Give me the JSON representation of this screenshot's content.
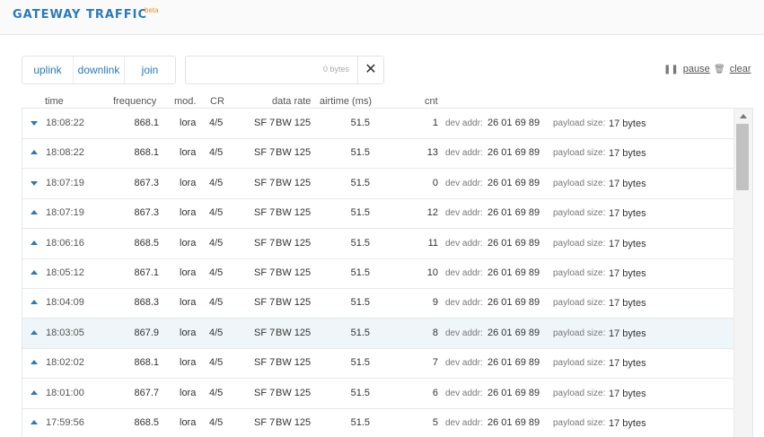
{
  "header": {
    "title": "GATEWAY TRAFFIC",
    "badge": "beta"
  },
  "filters": [
    "uplink",
    "downlink",
    "join"
  ],
  "search": {
    "value": "",
    "bytes_label": "0 bytes",
    "clear_glyph": "✕"
  },
  "controls": {
    "pause_label": "pause",
    "clear_label": "clear",
    "pause_icon": "pause-icon",
    "clear_icon": "trash-icon"
  },
  "columns": {
    "time": "time",
    "frequency": "frequency",
    "mod": "mod.",
    "cr": "CR",
    "data_rate": "data rate",
    "airtime": "airtime (ms)",
    "cnt": "cnt"
  },
  "field_labels": {
    "dev_addr": "dev addr:",
    "payload_size": "payload size:"
  },
  "rows": [
    {
      "direction": "down",
      "time": "18:08:22",
      "frequency": "868.1",
      "mod": "lora",
      "cr": "4/5",
      "sf": "SF 7",
      "bw": "BW 125",
      "airtime": "51.5",
      "cnt": "1",
      "dev_addr": "26 01 69 89",
      "payload": "17 bytes"
    },
    {
      "direction": "up",
      "time": "18:08:22",
      "frequency": "868.1",
      "mod": "lora",
      "cr": "4/5",
      "sf": "SF 7",
      "bw": "BW 125",
      "airtime": "51.5",
      "cnt": "13",
      "dev_addr": "26 01 69 89",
      "payload": "17 bytes"
    },
    {
      "direction": "down",
      "time": "18:07:19",
      "frequency": "867.3",
      "mod": "lora",
      "cr": "4/5",
      "sf": "SF 7",
      "bw": "BW 125",
      "airtime": "51.5",
      "cnt": "0",
      "dev_addr": "26 01 69 89",
      "payload": "17 bytes"
    },
    {
      "direction": "up",
      "time": "18:07:19",
      "frequency": "867.3",
      "mod": "lora",
      "cr": "4/5",
      "sf": "SF 7",
      "bw": "BW 125",
      "airtime": "51.5",
      "cnt": "12",
      "dev_addr": "26 01 69 89",
      "payload": "17 bytes"
    },
    {
      "direction": "up",
      "time": "18:06:16",
      "frequency": "868.5",
      "mod": "lora",
      "cr": "4/5",
      "sf": "SF 7",
      "bw": "BW 125",
      "airtime": "51.5",
      "cnt": "11",
      "dev_addr": "26 01 69 89",
      "payload": "17 bytes"
    },
    {
      "direction": "up",
      "time": "18:05:12",
      "frequency": "867.1",
      "mod": "lora",
      "cr": "4/5",
      "sf": "SF 7",
      "bw": "BW 125",
      "airtime": "51.5",
      "cnt": "10",
      "dev_addr": "26 01 69 89",
      "payload": "17 bytes"
    },
    {
      "direction": "up",
      "time": "18:04:09",
      "frequency": "868.3",
      "mod": "lora",
      "cr": "4/5",
      "sf": "SF 7",
      "bw": "BW 125",
      "airtime": "51.5",
      "cnt": "9",
      "dev_addr": "26 01 69 89",
      "payload": "17 bytes"
    },
    {
      "direction": "up",
      "time": "18:03:05",
      "frequency": "867.9",
      "mod": "lora",
      "cr": "4/5",
      "sf": "SF 7",
      "bw": "BW 125",
      "airtime": "51.5",
      "cnt": "8",
      "dev_addr": "26 01 69 89",
      "payload": "17 bytes",
      "highlighted": true
    },
    {
      "direction": "up",
      "time": "18:02:02",
      "frequency": "868.1",
      "mod": "lora",
      "cr": "4/5",
      "sf": "SF 7",
      "bw": "BW 125",
      "airtime": "51.5",
      "cnt": "7",
      "dev_addr": "26 01 69 89",
      "payload": "17 bytes"
    },
    {
      "direction": "up",
      "time": "18:01:00",
      "frequency": "867.7",
      "mod": "lora",
      "cr": "4/5",
      "sf": "SF 7",
      "bw": "BW 125",
      "airtime": "51.5",
      "cnt": "6",
      "dev_addr": "26 01 69 89",
      "payload": "17 bytes"
    },
    {
      "direction": "up",
      "time": "17:59:56",
      "frequency": "868.5",
      "mod": "lora",
      "cr": "4/5",
      "sf": "SF 7",
      "bw": "BW 125",
      "airtime": "51.5",
      "cnt": "5",
      "dev_addr": "26 01 69 89",
      "payload": "17 bytes"
    }
  ],
  "colors": {
    "accent": "#2a7ab8",
    "badge": "#e8951a",
    "highlight_row": "#eef6f9"
  }
}
